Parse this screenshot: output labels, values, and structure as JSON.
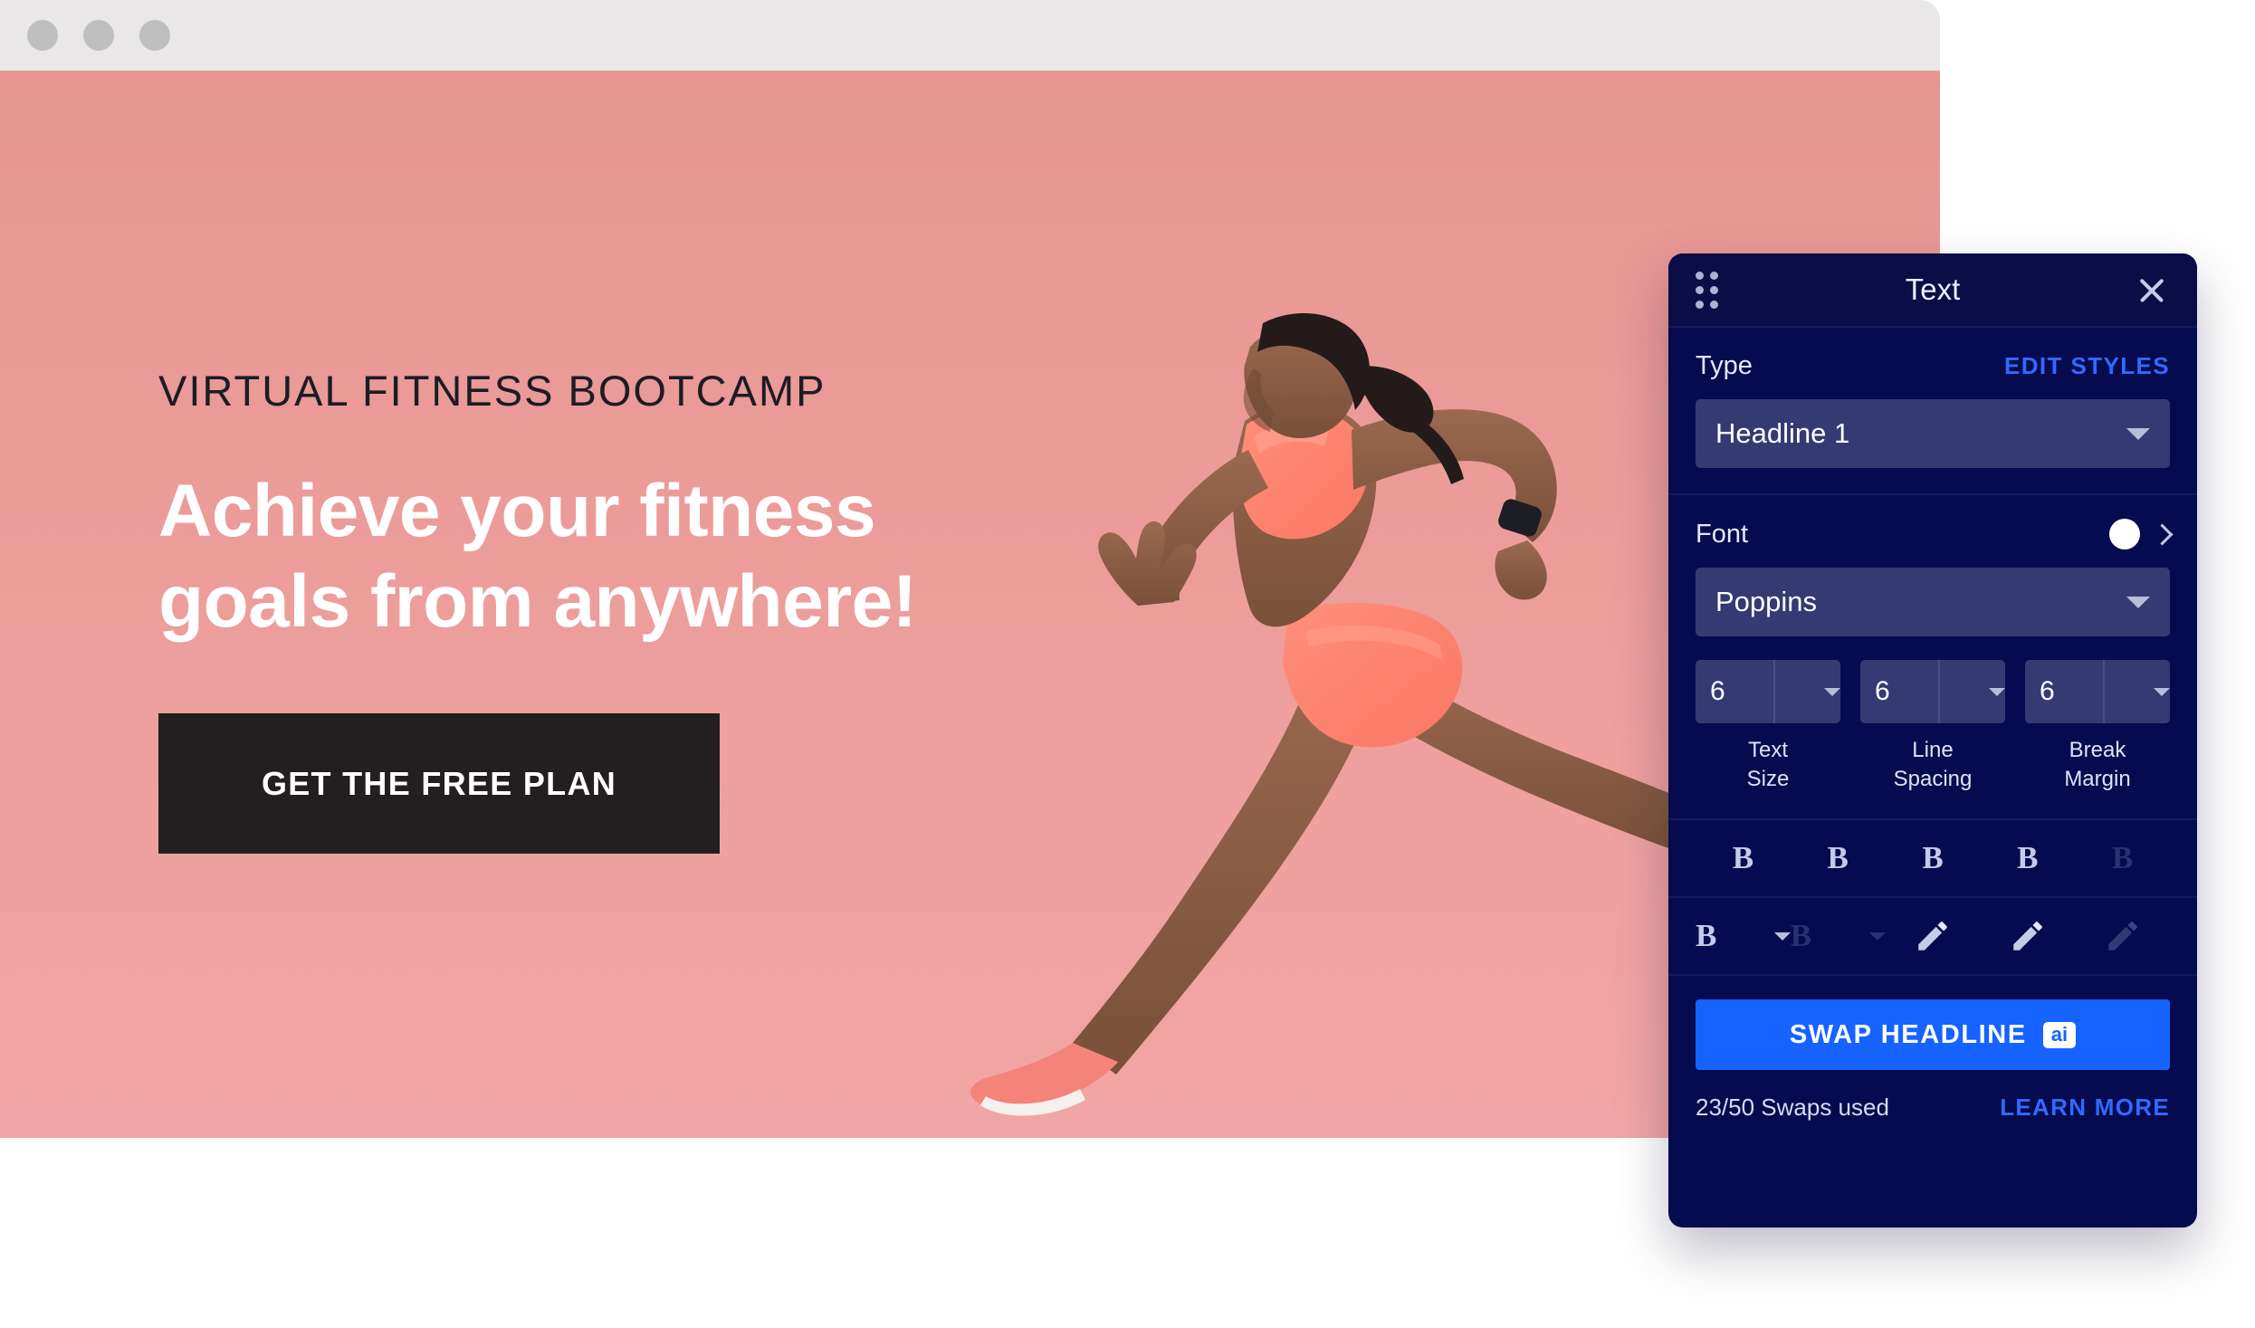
{
  "browser": {
    "window_dots": [
      "dot-red",
      "dot-yellow",
      "dot-green"
    ]
  },
  "hero": {
    "eyebrow": "VIRTUAL FITNESS BOOTCAMP",
    "headline_line1": "Achieve your fitness",
    "headline_line2": "goals from anywhere!",
    "cta_label": "GET THE FREE PLAN",
    "background_top": "#e89591",
    "background_bottom": "#f0a6a4",
    "cta_background": "#231f20",
    "photo_alt": "woman running in coral sportswear"
  },
  "panel": {
    "title": "Text",
    "close_icon": "close-icon",
    "drag_icon": "drag-handle-icon",
    "type_section": {
      "label": "Type",
      "edit_styles_label": "EDIT STYLES",
      "selected_type": "Headline 1"
    },
    "font_section": {
      "label": "Font",
      "selected_font": "Poppins",
      "swatch_color": "#ffffff",
      "steppers": [
        {
          "value": "6",
          "caption_line1": "Text",
          "caption_line2": "Size"
        },
        {
          "value": "6",
          "caption_line1": "Line",
          "caption_line2": "Spacing"
        },
        {
          "value": "6",
          "caption_line1": "Break",
          "caption_line2": "Margin"
        }
      ]
    },
    "style_row": [
      {
        "glyph": "B",
        "name": "bold-icon",
        "dim": false
      },
      {
        "glyph": "B",
        "name": "italic-icon",
        "dim": false
      },
      {
        "glyph": "B",
        "name": "underline-icon",
        "dim": false
      },
      {
        "glyph": "B",
        "name": "strikethrough-icon",
        "dim": false
      },
      {
        "glyph": "B",
        "name": "uppercase-icon",
        "dim": true
      }
    ],
    "color_row": [
      {
        "type": "glyph-caret",
        "glyph": "B",
        "name": "text-color-icon",
        "dim": false
      },
      {
        "type": "glyph-caret",
        "glyph": "B",
        "name": "highlight-color-icon",
        "dim": true
      },
      {
        "type": "pencil",
        "name": "pencil-icon",
        "dim": false
      },
      {
        "type": "pencil",
        "name": "pencil-alt-icon",
        "dim": false
      },
      {
        "type": "pencil",
        "name": "pencil-muted-icon",
        "dim": true
      }
    ],
    "swap": {
      "button_label": "SWAP HEADLINE",
      "badge_label": "ai",
      "usage_text": "23/50 Swaps used",
      "learn_more_label": "LEARN MORE",
      "button_color": "#1663ff"
    },
    "colors": {
      "panel_background": "#060a4f",
      "header_background": "#0a0d46",
      "control_background": "#363a72",
      "accent_link": "#2f6bff"
    }
  }
}
